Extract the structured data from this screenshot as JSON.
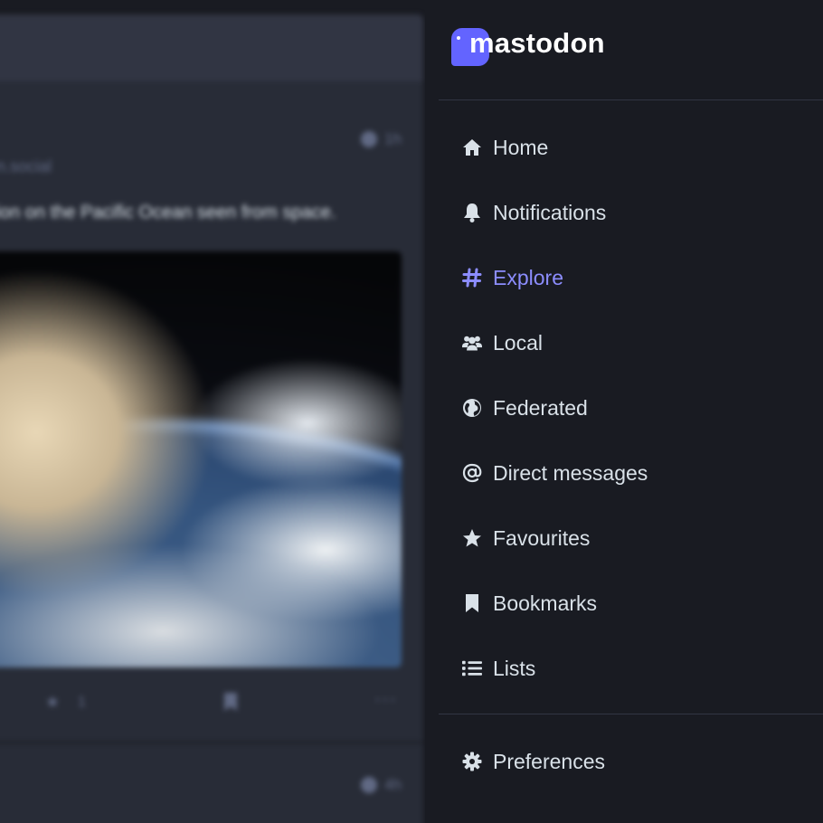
{
  "colors": {
    "background": "#191b22",
    "column_header": "#313543",
    "status_card": "#282c37",
    "nav_text": "#d9e1e8",
    "accent": "#8c8dff",
    "logo_mark": "#6364ff",
    "muted": "#606984"
  },
  "brand": {
    "name": "mastodon",
    "icon": "mastodon-logo-icon"
  },
  "timeline": {
    "status": {
      "time": "1h",
      "handle": "on.social",
      "text": "tion on the Pacific Ocean seen from space.",
      "favourite_count": "1"
    },
    "next_status": {
      "time": "4h"
    }
  },
  "nav": {
    "items": [
      {
        "label": "Home",
        "icon": "home-icon",
        "active": false
      },
      {
        "label": "Notifications",
        "icon": "bell-icon",
        "active": false
      },
      {
        "label": "Explore",
        "icon": "hashtag-icon",
        "active": true
      },
      {
        "label": "Local",
        "icon": "users-icon",
        "active": false
      },
      {
        "label": "Federated",
        "icon": "globe-icon",
        "active": false
      },
      {
        "label": "Direct messages",
        "icon": "at-icon",
        "active": false
      },
      {
        "label": "Favourites",
        "icon": "star-icon",
        "active": false
      },
      {
        "label": "Bookmarks",
        "icon": "bookmark-icon",
        "active": false
      },
      {
        "label": "Lists",
        "icon": "list-icon",
        "active": false
      }
    ],
    "preferences": {
      "label": "Preferences",
      "icon": "gear-icon"
    }
  }
}
